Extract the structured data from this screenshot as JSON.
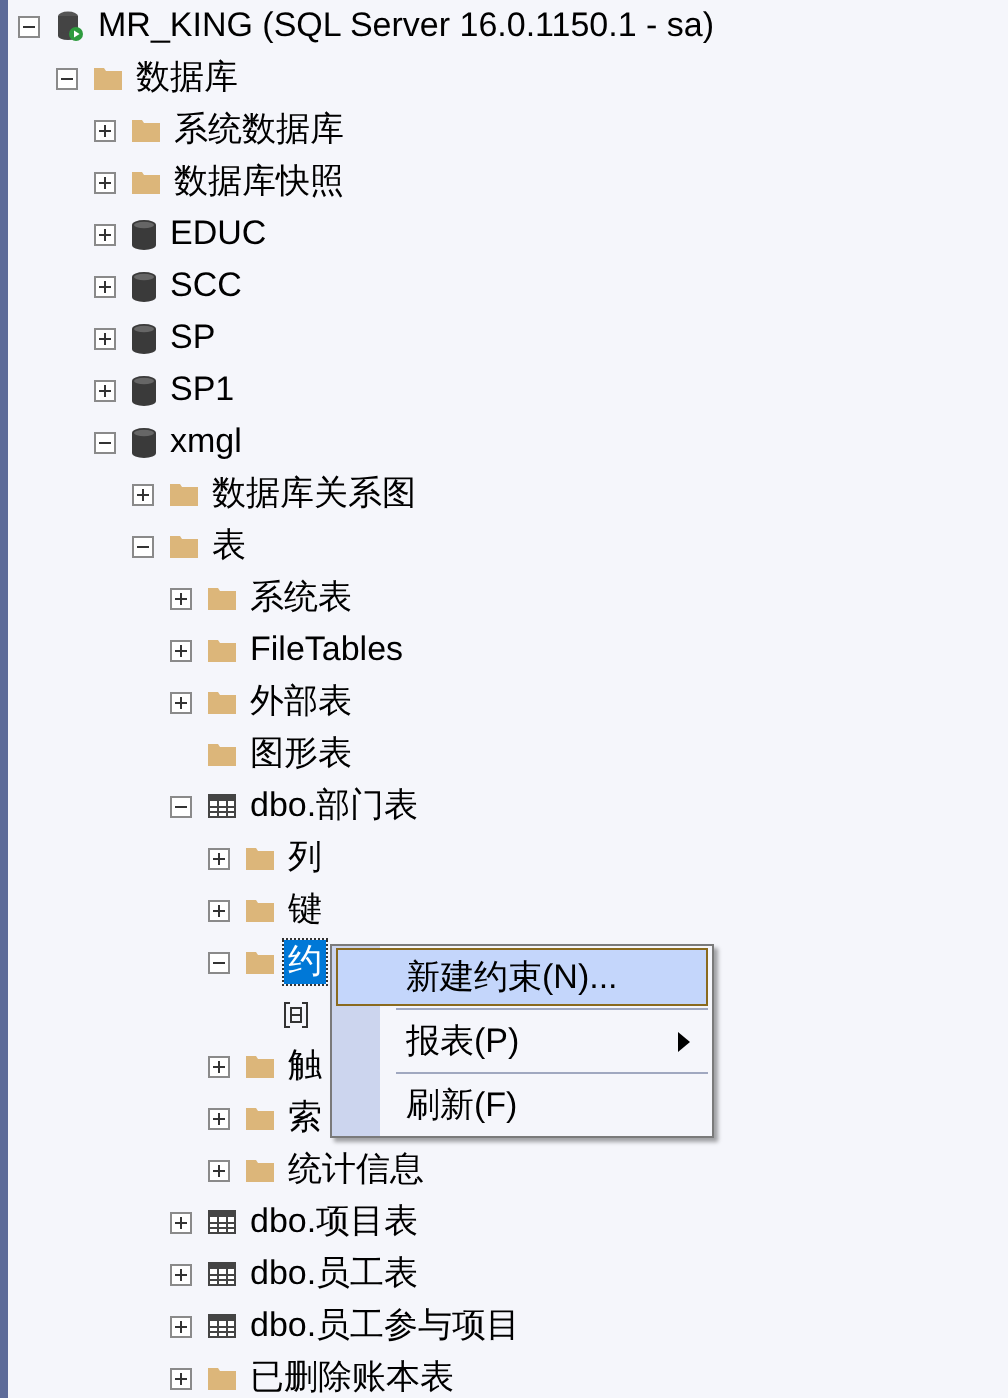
{
  "tree": [
    {
      "label": "MR_KING (SQL Server 16.0.1150.1 - sa)",
      "kind": "server",
      "expanded": true,
      "selected": false,
      "children": [
        {
          "label": "数据库",
          "kind": "folder",
          "expanded": true,
          "selected": false,
          "children": [
            {
              "label": "系统数据库",
              "kind": "folder",
              "expanded": false,
              "selected": false
            },
            {
              "label": "数据库快照",
              "kind": "folder",
              "expanded": false,
              "selected": false
            },
            {
              "label": "EDUC",
              "kind": "database",
              "expanded": false,
              "selected": false
            },
            {
              "label": "SCC",
              "kind": "database",
              "expanded": false,
              "selected": false
            },
            {
              "label": "SP",
              "kind": "database",
              "expanded": false,
              "selected": false
            },
            {
              "label": "SP1",
              "kind": "database",
              "expanded": false,
              "selected": false
            },
            {
              "label": "xmgl",
              "kind": "database",
              "expanded": true,
              "selected": false,
              "children": [
                {
                  "label": "数据库关系图",
                  "kind": "folder",
                  "expanded": false,
                  "selected": false
                },
                {
                  "label": "表",
                  "kind": "folder",
                  "expanded": true,
                  "selected": false,
                  "children": [
                    {
                      "label": "系统表",
                      "kind": "folder",
                      "expanded": false,
                      "selected": false
                    },
                    {
                      "label": "FileTables",
                      "kind": "folder",
                      "expanded": false,
                      "selected": false
                    },
                    {
                      "label": "外部表",
                      "kind": "folder",
                      "expanded": false,
                      "selected": false
                    },
                    {
                      "label": "图形表",
                      "kind": "folder",
                      "selected": false
                    },
                    {
                      "label": "dbo.部门表",
                      "kind": "table",
                      "expanded": true,
                      "selected": false,
                      "children": [
                        {
                          "label": "列",
                          "kind": "folder",
                          "expanded": false,
                          "selected": false
                        },
                        {
                          "label": "键",
                          "kind": "folder",
                          "expanded": false,
                          "selected": false
                        },
                        {
                          "label": "约",
                          "kind": "folder",
                          "expanded": true,
                          "selected": true,
                          "children": [
                            {
                              "kind": "constraint"
                            }
                          ]
                        },
                        {
                          "label": "触",
                          "kind": "folder",
                          "expanded": false,
                          "selected": false
                        },
                        {
                          "label": "索",
                          "kind": "folder",
                          "expanded": false,
                          "selected": false
                        },
                        {
                          "label": "统计信息",
                          "kind": "folder",
                          "expanded": false,
                          "selected": false
                        }
                      ]
                    },
                    {
                      "label": "dbo.项目表",
                      "kind": "table",
                      "expanded": false,
                      "selected": false
                    },
                    {
                      "label": "dbo.员工表",
                      "kind": "table",
                      "expanded": false,
                      "selected": false
                    },
                    {
                      "label": "dbo.员工参与项目",
                      "kind": "table",
                      "expanded": false,
                      "selected": false
                    },
                    {
                      "label": "已删除账本表",
                      "kind": "folder",
                      "expanded": false,
                      "selected": false
                    }
                  ]
                }
              ]
            }
          ]
        }
      ]
    }
  ],
  "context_menu": [
    {
      "label": "新建约束(N)...",
      "selected": true,
      "submenu": false
    },
    {
      "label": "报表(P)",
      "selected": false,
      "submenu": true
    },
    {
      "label": "刷新(F)",
      "selected": false,
      "submenu": false
    }
  ]
}
